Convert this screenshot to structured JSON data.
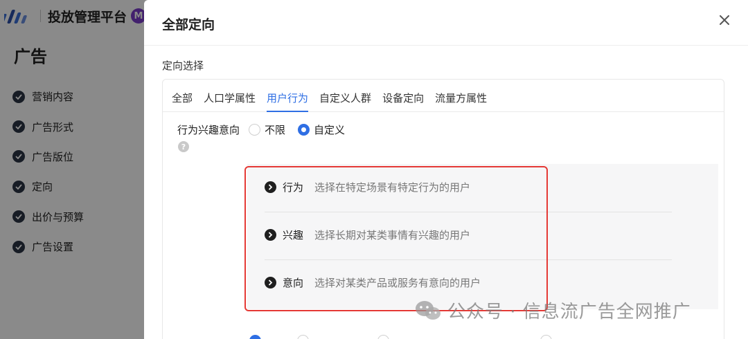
{
  "app": {
    "platform_title": "投放管理平台",
    "avatar_letter": "M",
    "section_heading": "广告",
    "steps": [
      {
        "label": "营销内容"
      },
      {
        "label": "广告形式"
      },
      {
        "label": "广告版位"
      },
      {
        "label": "定向"
      },
      {
        "label": "出价与预算"
      },
      {
        "label": "广告设置"
      }
    ]
  },
  "modal": {
    "title": "全部定向",
    "section_label": "定向选择",
    "tabs": [
      {
        "label": "全部"
      },
      {
        "label": "人口学属性"
      },
      {
        "label": "用户行为"
      },
      {
        "label": "自定义人群"
      },
      {
        "label": "设备定向"
      },
      {
        "label": "流量方属性"
      }
    ],
    "active_tab": "用户行为",
    "interest": {
      "label": "行为兴趣意向",
      "help": "?",
      "options": [
        {
          "label": "不限",
          "checked": false
        },
        {
          "label": "自定义",
          "checked": true
        }
      ]
    },
    "behavior_options": [
      {
        "title": "行为",
        "desc": "选择在特定场景有特定行为的用户"
      },
      {
        "title": "兴趣",
        "desc": "选择长期对某类事情有兴趣的用户"
      },
      {
        "title": "意向",
        "desc": "选择对某类产品或服务有意向的用户"
      }
    ]
  },
  "watermark": {
    "text": "公众号 · 信息流广告全网推广"
  },
  "colors": {
    "accent": "#2f6fe4",
    "highlight": "#e53935",
    "step_check": "#2b3445"
  },
  "icons": {
    "close": "close-icon",
    "step": "check-circle-icon",
    "option": "chevron-right-circle-icon",
    "help": "question-circle-icon"
  }
}
